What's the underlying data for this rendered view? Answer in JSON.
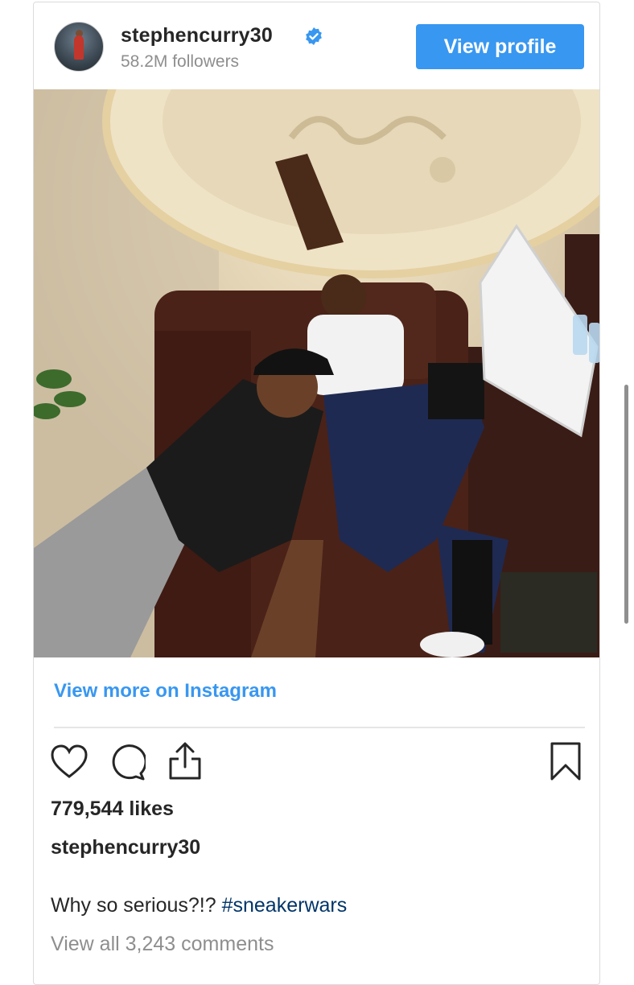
{
  "header": {
    "username": "stephencurry30",
    "followers": "58.2M followers",
    "view_profile_label": "View profile"
  },
  "post": {
    "view_more_label": "View more on Instagram",
    "likes": "779,544 likes",
    "caption_user": "stephencurry30",
    "caption_text": "Why so serious?!? ",
    "hashtag": "#sneakerwars",
    "comments_label": "View all 3,243 comments"
  },
  "icons": {
    "verified": "verified-badge-icon",
    "like": "heart-icon",
    "comment": "comment-bubble-icon",
    "share": "share-upload-icon",
    "save": "bookmark-icon"
  },
  "colors": {
    "accent_blue": "#3897f0",
    "hashtag_blue": "#003569",
    "text_primary": "#262626",
    "text_secondary": "#8e8e8e",
    "border": "#dbdbdb"
  }
}
